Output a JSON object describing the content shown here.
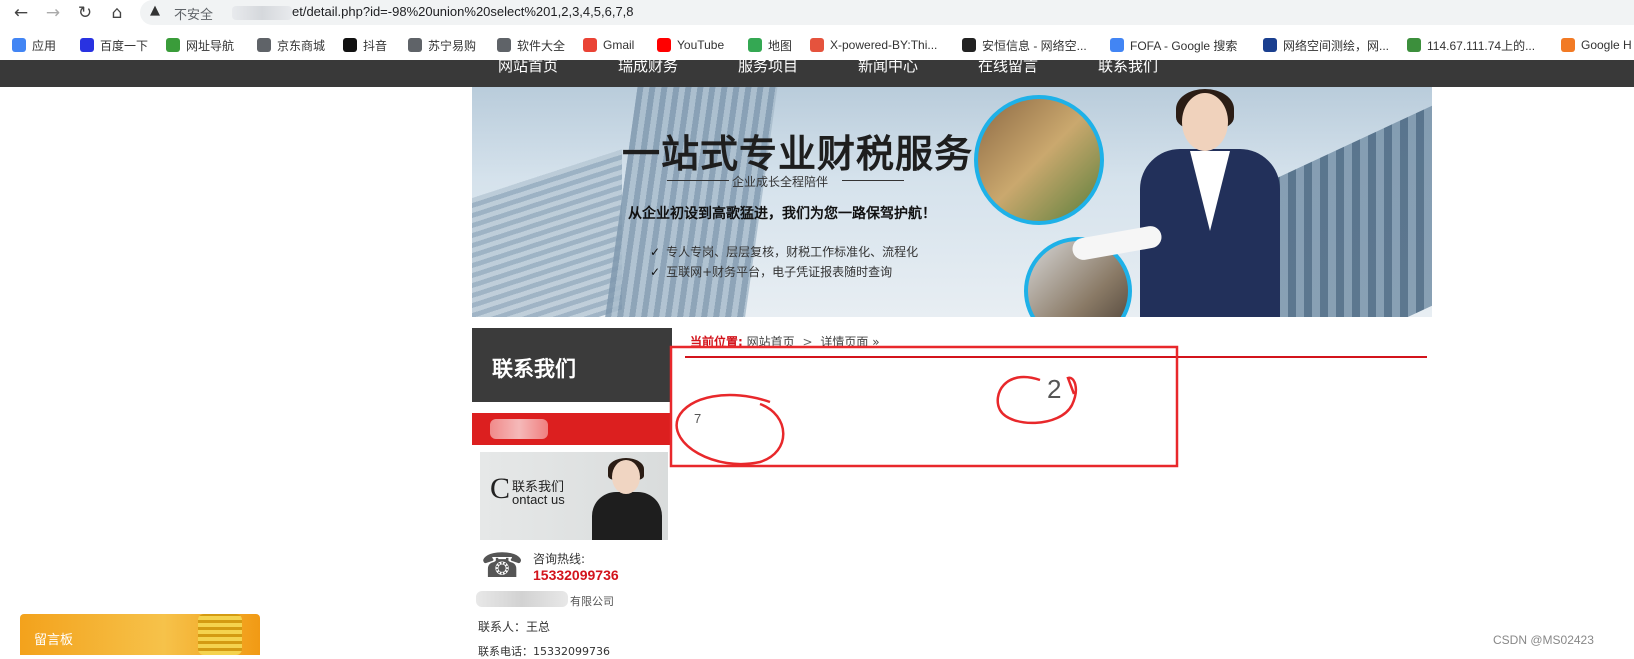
{
  "browser": {
    "security_label": "不安全",
    "url_path": "et/detail.php?id=-98%20union%20select%201,2,3,4,5,6,7,8",
    "bookmarks": [
      {
        "label": "应用",
        "icon": "apps-grid-icon",
        "color": "#4285f4"
      },
      {
        "label": "百度一下",
        "icon": "baidu-paw-icon",
        "color": "#2932e1"
      },
      {
        "label": "网址导航",
        "icon": "nav-house-icon",
        "color": "#3a9c3a"
      },
      {
        "label": "京东商城",
        "icon": "globe-icon",
        "color": "#5f6368"
      },
      {
        "label": "抖音",
        "icon": "douyin-note-icon",
        "color": "#111111"
      },
      {
        "label": "苏宁易购",
        "icon": "globe-icon",
        "color": "#5f6368"
      },
      {
        "label": "软件大全",
        "icon": "globe-icon",
        "color": "#5f6368"
      },
      {
        "label": "Gmail",
        "icon": "gmail-icon",
        "color": "#ea4335"
      },
      {
        "label": "YouTube",
        "icon": "youtube-icon",
        "color": "#ff0000"
      },
      {
        "label": "地图",
        "icon": "maps-pin-icon",
        "color": "#34a853"
      },
      {
        "label": "X-powered-BY:Thi...",
        "icon": "rings-icon",
        "color": "#e5533d"
      },
      {
        "label": "安恒信息 - 网络空...",
        "icon": "anheng-icon",
        "color": "#222222"
      },
      {
        "label": "FOFA - Google 搜索",
        "icon": "google-g-icon",
        "color": "#4285f4"
      },
      {
        "label": "网络空间测绘，网...",
        "icon": "fofa-icon",
        "color": "#1a3f8f"
      },
      {
        "label": "114.67.111.74上的...",
        "icon": "puzzle-icon",
        "color": "#3c8f3c"
      },
      {
        "label": "Google H",
        "icon": "google-h-icon",
        "color": "#f27a24"
      }
    ]
  },
  "site_nav": [
    "网站首页",
    "瑞成财务",
    "服务项目",
    "新闻中心",
    "在线留言",
    "联系我们"
  ],
  "banner": {
    "title": "一站式专业财税服务",
    "subtitle": "企业成长全程陪伴",
    "slogan": "从企业初设到高歌猛进，我们为您一路保驾护航！",
    "checks": [
      "专人专岗、层层复核，财税工作标准化、流程化",
      "互联网+财务平台，电子凭证报表随时查询"
    ]
  },
  "sidebar": {
    "heading": "联系我们",
    "image_cn": "联系我们",
    "image_big_letter": "C",
    "image_en": "ontact us",
    "hotline_label": "咨询热线:",
    "hotline_number": "15332099736",
    "company_suffix": "有限公司",
    "contact_person": "联系人：王总",
    "contact_phone": "联系电话：15332099736"
  },
  "content": {
    "breadcrumb_label": "当前位置:",
    "breadcrumb_home": "网站首页",
    "breadcrumb_sep": ">",
    "breadcrumb_page": "详情页面 »",
    "result_a": "2",
    "result_b": "7"
  },
  "widget": {
    "label": "留言板"
  },
  "watermark": "CSDN @MS02423",
  "colors": {
    "accent_red": "#d3141c",
    "annotation_red": "#e8282b",
    "nav_dark": "#393939"
  }
}
